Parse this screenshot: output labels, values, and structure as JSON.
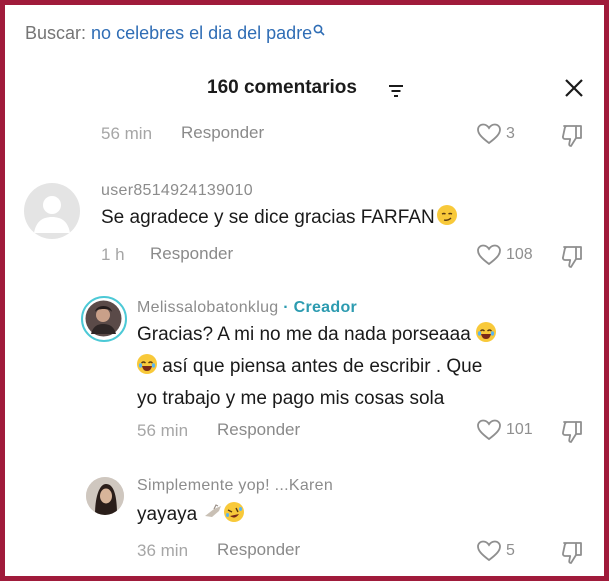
{
  "search": {
    "label": "Buscar:",
    "query": "no celebres el dia del padre"
  },
  "header": {
    "title": "160 comentarios"
  },
  "comments": [
    {
      "time": "56 min",
      "reply_label": "Responder",
      "likes": "3"
    },
    {
      "username": "user8514924139010",
      "text": "Se agradece y se dice gracias FARFAN",
      "time": "1 h",
      "reply_label": "Responder",
      "likes": "108"
    },
    {
      "username": "Melissalobatonklug",
      "badge": "· Creador",
      "text_line1": "Gracias? A mi no me da nada porseaaa",
      "text_line2": "así que piensa antes de escribir . Que",
      "text_line3": "yo trabajo y me pago mis cosas sola",
      "time": "56 min",
      "reply_label": "Responder",
      "likes": "101"
    },
    {
      "username": "Simplemente yop! ...Karen",
      "text": "yayaya",
      "time": "36 min",
      "reply_label": "Responder",
      "likes": "5"
    }
  ],
  "colors": {
    "border": "#a01b3b",
    "creator_badge": "#2c9bb0",
    "search_query": "#2f6db5"
  }
}
